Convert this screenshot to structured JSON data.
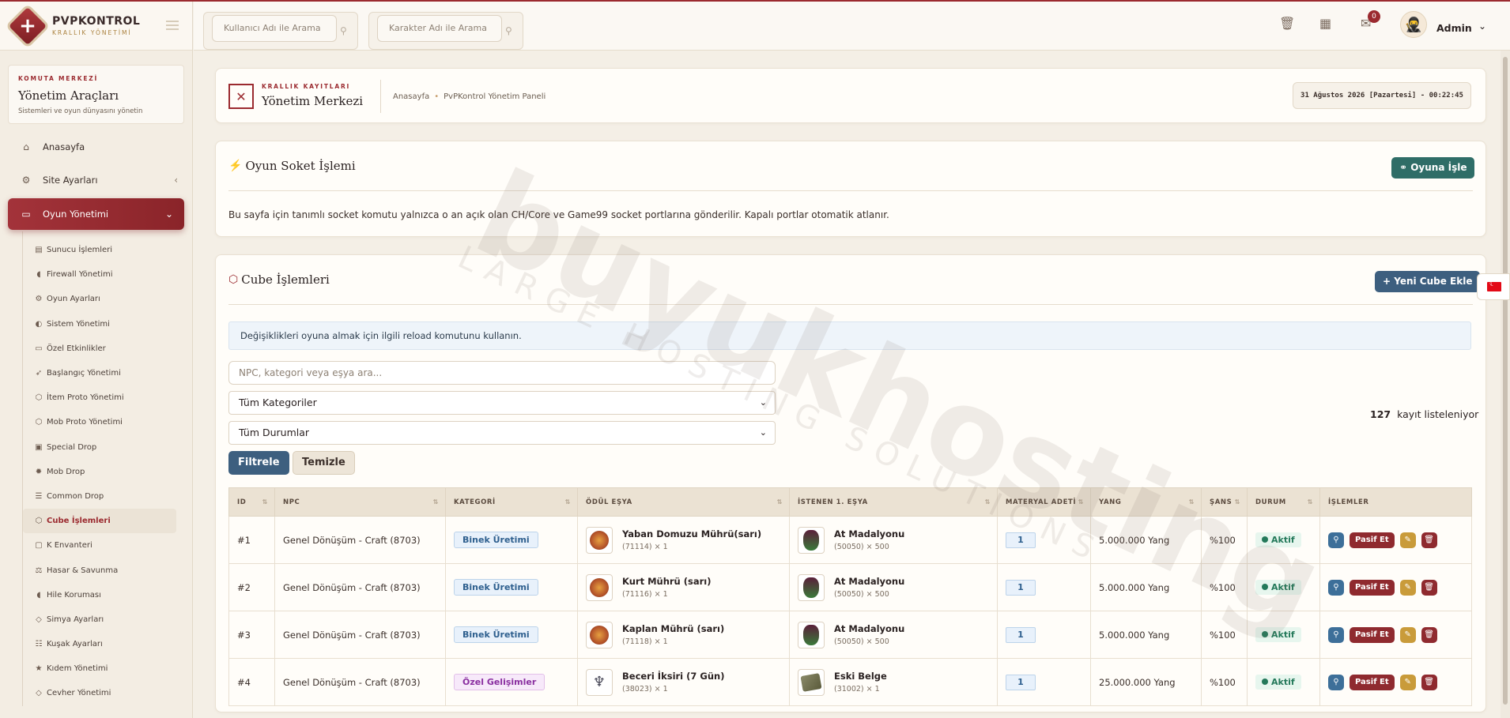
{
  "brand": {
    "title": "PVPKONTROL",
    "subtitle": "KRALLIK YÖNETİMİ"
  },
  "side_card": {
    "eyebrow": "KOMUTA MERKEZİ",
    "title": "Yönetim Araçları",
    "desc": "Sistemleri ve oyun dünyasını yönetin"
  },
  "nav": {
    "home": "Anasayfa",
    "site": "Site Ayarları",
    "game": "Oyun Yönetimi",
    "sub": [
      "Sunucu İşlemleri",
      "Firewall Yönetimi",
      "Oyun Ayarları",
      "Sistem Yönetimi",
      "Özel Etkinlikler",
      "Başlangıç Yönetimi",
      "İtem Proto Yönetimi",
      "Mob Proto Yönetimi",
      "Special Drop",
      "Mob Drop",
      "Common Drop",
      "Cube İşlemleri",
      "K Envanteri",
      "Hasar & Savunma",
      "Hile Koruması",
      "Simya Ayarları",
      "Kuşak Ayarları",
      "Kıdem Yönetimi",
      "Cevher Yönetimi"
    ]
  },
  "topbar": {
    "search_user": "Kullanıcı Adı ile Arama",
    "search_char": "Karakter Adı ile Arama",
    "notif_count": "0",
    "user": "Admin"
  },
  "header": {
    "eyebrow": "KRALLIK KAYITLARI",
    "title": "Yönetim Merkezi",
    "crumb_home": "Anasayfa",
    "crumb_panel": "PvPKontrol Yönetim Paneli",
    "datetime": "31 Ağustos 2026 [Pazartesi] - 00:22:45"
  },
  "socket": {
    "title": "Oyun Soket İşlemi",
    "button": "Oyuna İşle",
    "desc": "Bu sayfa için tanımlı socket komutu yalnızca o an açık olan CH/Core ve Game99 socket portlarına gönderilir. Kapalı portlar otomatik atlanır."
  },
  "cube": {
    "title": "Cube İşlemleri",
    "add_button": "Yeni Cube Ekle",
    "info": "Değişiklikleri oyuna almak için ilgili reload komutunu kullanın.",
    "search_placeholder": "NPC, kategori veya eşya ara...",
    "category_select": "Tüm Kategoriler",
    "status_select": "Tüm Durumlar",
    "filter_button": "Filtrele",
    "clear_button": "Temizle",
    "count": "127",
    "count_label": "kayıt listeleniyor",
    "columns": [
      "ID",
      "NPC",
      "KATEGORİ",
      "ÖDÜL EŞYA",
      "İSTENEN 1. EŞYA",
      "MATERYAL ADETİ",
      "YANG",
      "ŞANS",
      "DURUM",
      "İŞLEMLER"
    ],
    "passive_label": "Pasif Et",
    "rows": [
      {
        "id": "#1",
        "npc": "Genel Dönüşüm - Craft (8703)",
        "category": "Binek Üretimi",
        "cat_style": "blue",
        "reward_name": "Yaban Domuzu Mührü(sarı)",
        "reward_sub": "(71114) × 1",
        "reward_icon": "seal",
        "req_name": "At Madalyonu",
        "req_sub": "(50050) × 500",
        "req_icon": "medal",
        "qty": "1",
        "yang": "5.000.000 Yang",
        "chance": "%100",
        "status": "Aktif"
      },
      {
        "id": "#2",
        "npc": "Genel Dönüşüm - Craft (8703)",
        "category": "Binek Üretimi",
        "cat_style": "blue",
        "reward_name": "Kurt Mührü (sarı)",
        "reward_sub": "(71116) × 1",
        "reward_icon": "seal",
        "req_name": "At Madalyonu",
        "req_sub": "(50050) × 500",
        "req_icon": "medal",
        "qty": "1",
        "yang": "5.000.000 Yang",
        "chance": "%100",
        "status": "Aktif"
      },
      {
        "id": "#3",
        "npc": "Genel Dönüşüm - Craft (8703)",
        "category": "Binek Üretimi",
        "cat_style": "blue",
        "reward_name": "Kaplan Mührü (sarı)",
        "reward_sub": "(71118) × 1",
        "reward_icon": "seal",
        "req_name": "At Madalyonu",
        "req_sub": "(50050) × 500",
        "req_icon": "medal",
        "qty": "1",
        "yang": "5.000.000 Yang",
        "chance": "%100",
        "status": "Aktif"
      },
      {
        "id": "#4",
        "npc": "Genel Dönüşüm - Craft (8703)",
        "category": "Özel Gelişimler",
        "cat_style": "purple",
        "reward_name": "Beceri İksiri (7 Gün)",
        "reward_sub": "(38023) × 1",
        "reward_icon": "wings",
        "req_name": "Eski Belge",
        "req_sub": "(31002) × 1",
        "req_icon": "doc",
        "qty": "1",
        "yang": "25.000.000 Yang",
        "chance": "%100",
        "status": "Aktif"
      }
    ]
  },
  "watermark": {
    "main": "buyukhosting",
    "sub": "LARGE HOSTING SOLUTIONS"
  }
}
